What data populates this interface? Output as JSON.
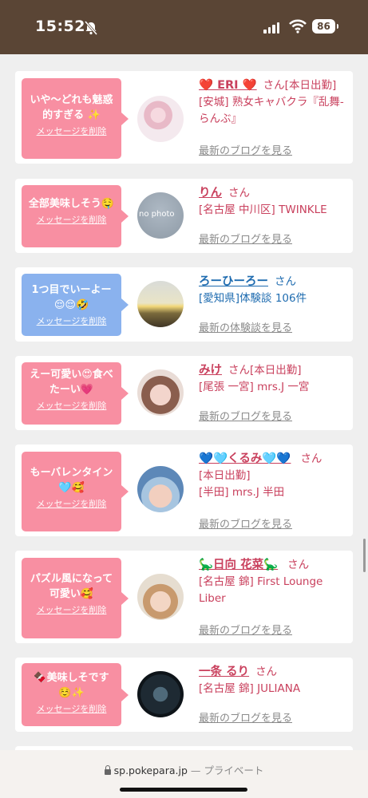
{
  "status": {
    "time": "15:52",
    "battery": "86"
  },
  "messages": [
    {
      "message": "いや〜どれも魅惑的すぎる ✨",
      "delete": "メッセージを削除",
      "name": "❤️ ERI ❤️",
      "san": "さん",
      "badge": "[本日出勤]",
      "lines": [
        "[安城] 熟女キャバクラ『乱舞-らんぶ』"
      ],
      "link": "最新のブログを見る",
      "color": "pink"
    },
    {
      "message": "全部美味しそう🤤",
      "delete": "メッセージを削除",
      "name": "りん",
      "san": "さん",
      "badge": "",
      "lines": [
        "[名古屋 中川区] TWINKLE"
      ],
      "link": "最新のブログを見る",
      "color": "pink"
    },
    {
      "message": "1つ目でいーよー 😌😌🤣",
      "delete": "メッセージを削除",
      "name": "ろーひーろー",
      "san": "さん",
      "badge": "",
      "lines": [
        "[愛知県]体験談 106件"
      ],
      "link": "最新の体験談を見る",
      "color": "blue"
    },
    {
      "message": "えー可愛い😍食べたーい💗",
      "delete": "メッセージを削除",
      "name": "みけ",
      "san": "さん",
      "badge": "[本日出勤]",
      "lines": [
        "[尾張 一宮] mrs.J 一宮"
      ],
      "link": "最新のブログを見る",
      "color": "pink"
    },
    {
      "message": "もーバレンタイン🩵🥰",
      "delete": "メッセージを削除",
      "name": "💙🩵くるみ🩵💙",
      "san": "さん",
      "badge": "",
      "lines": [
        "[本日出勤]",
        "[半田] mrs.J 半田"
      ],
      "link": "最新のブログを見る",
      "color": "pink"
    },
    {
      "message": "パズル風になって可愛い🥰",
      "delete": "メッセージを削除",
      "name": "🦕日向 花菜🦕",
      "san": "さん",
      "badge": "",
      "lines": [
        "[名古屋 錦] First Lounge Liber"
      ],
      "link": "最新のブログを見る",
      "color": "pink"
    },
    {
      "message": "🍫美味しそです ☺️✨",
      "delete": "メッセージを削除",
      "name": "一条 るり",
      "san": "さん",
      "badge": "",
      "lines": [
        "[名古屋 錦] JULIANA"
      ],
      "link": "最新のブログを見る",
      "color": "pink"
    }
  ],
  "avatars": [
    {
      "label": ""
    },
    {
      "label": "no photo"
    },
    {
      "label": ""
    },
    {
      "label": ""
    },
    {
      "label": ""
    },
    {
      "label": ""
    },
    {
      "label": ""
    }
  ],
  "browser": {
    "url": "sp.pokepara.jp",
    "sep": "—",
    "privacy": "プライベート"
  }
}
